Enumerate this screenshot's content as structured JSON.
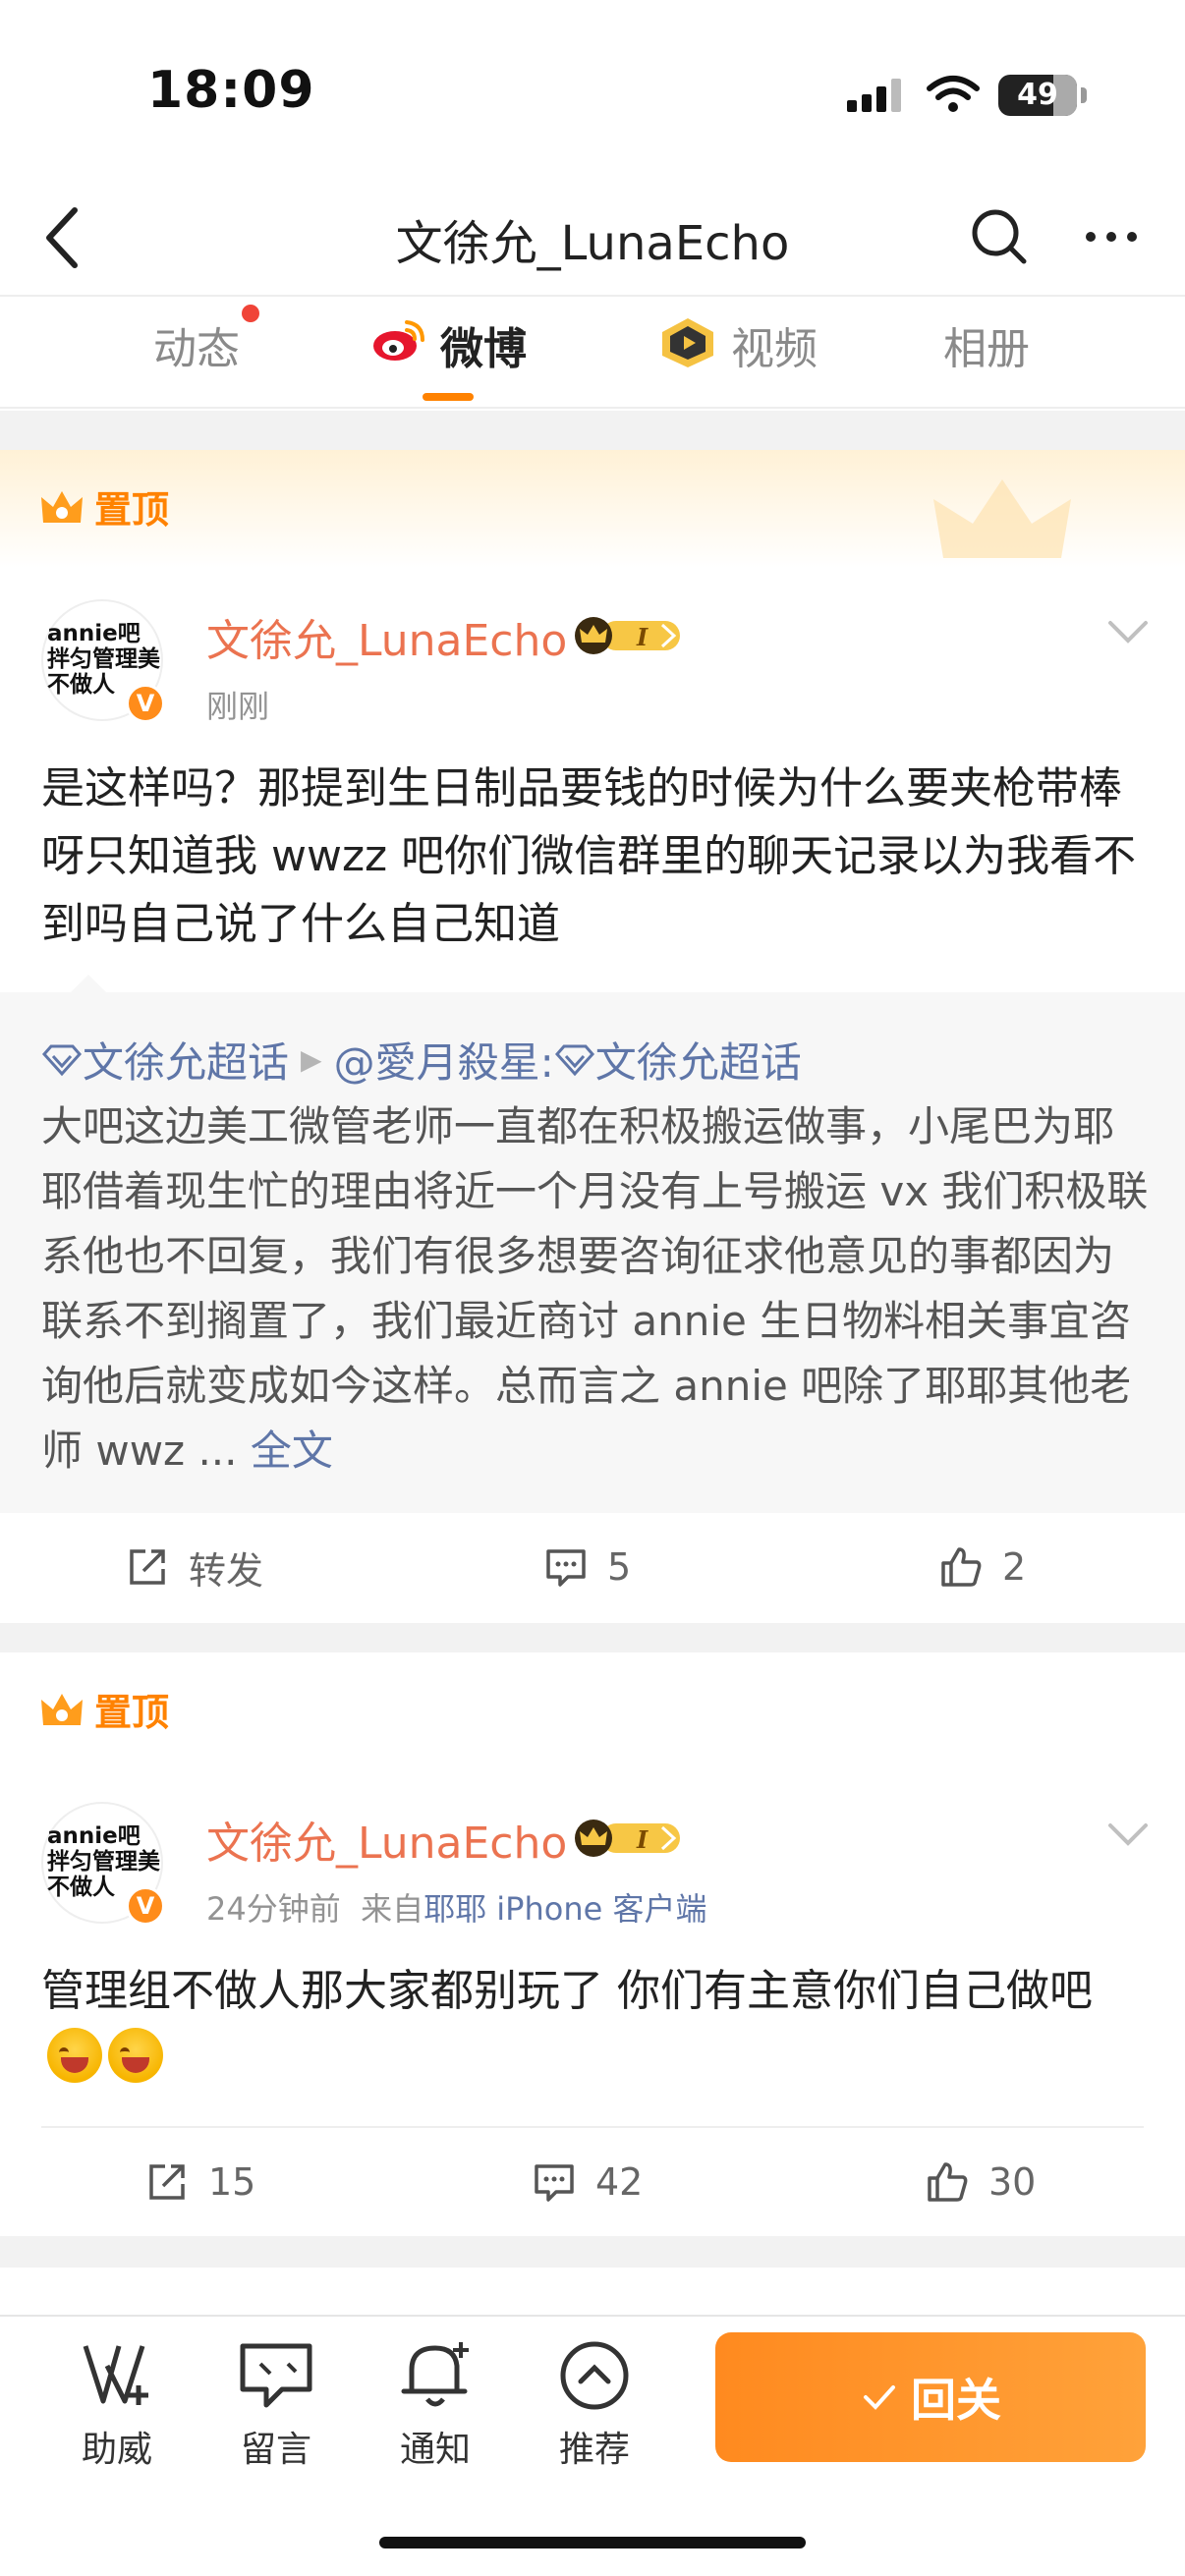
{
  "status_bar": {
    "time": "18:09",
    "battery": "49"
  },
  "nav": {
    "title": "文徐允_LunaEcho"
  },
  "tabs": [
    {
      "label": "动态"
    },
    {
      "label": "微博"
    },
    {
      "label": "视频"
    },
    {
      "label": "相册"
    }
  ],
  "pinned_label": "置顶",
  "posts": [
    {
      "avatar_text": "annie吧 拌匀管理美 不做人",
      "author": "文徐允_LunaEcho",
      "time": "刚刚",
      "text": "是这样吗？那提到生日制品要钱的时候为什么要夹枪带棒呀只知道我 wwzz 吧你们微信群里的聊天记录以为我看不到吗自己说了什么自己知道",
      "repost": {
        "topic": "文徐允超话",
        "user": "@愛月殺星:",
        "topic2": "文徐允超话",
        "text": " 大吧这边美工微管老师一直都在积极搬运做事，小尾巴为耶耶借着现生忙的理由将近一个月没有上号搬运 vx 我们积极联系他也不回复，我们有很多想要咨询征求他意见的事都因为联系不到搁置了，我们最近商讨 annie 生日物料相关事宜咨询他后就变成如今这样。总而言之 annie 吧除了耶耶其他老师 wwz ... ",
        "more": "全文"
      },
      "actions": {
        "repost": "转发",
        "comments": "5",
        "likes": "2"
      }
    },
    {
      "avatar_text": "annie吧 拌匀管理美 不做人",
      "author": "文徐允_LunaEcho",
      "time": "24分钟前",
      "from_prefix": "来自",
      "source": "耶耶 iPhone 客户端",
      "text": "管理组不做人那大家都别玩了 你们有主意你们自己做吧",
      "actions": {
        "repost": "15",
        "comments": "42",
        "likes": "30"
      }
    }
  ],
  "bottom_bar": {
    "items": [
      {
        "label": "助威",
        "icon": "cheer-icon"
      },
      {
        "label": "留言",
        "icon": "message-icon"
      },
      {
        "label": "通知",
        "icon": "bell-icon"
      },
      {
        "label": "推荐",
        "icon": "recommend-icon"
      }
    ],
    "follow_label": "回关"
  },
  "colors": {
    "accent": "#ff8200",
    "author": "#eb7350",
    "link": "#5f76a8"
  }
}
